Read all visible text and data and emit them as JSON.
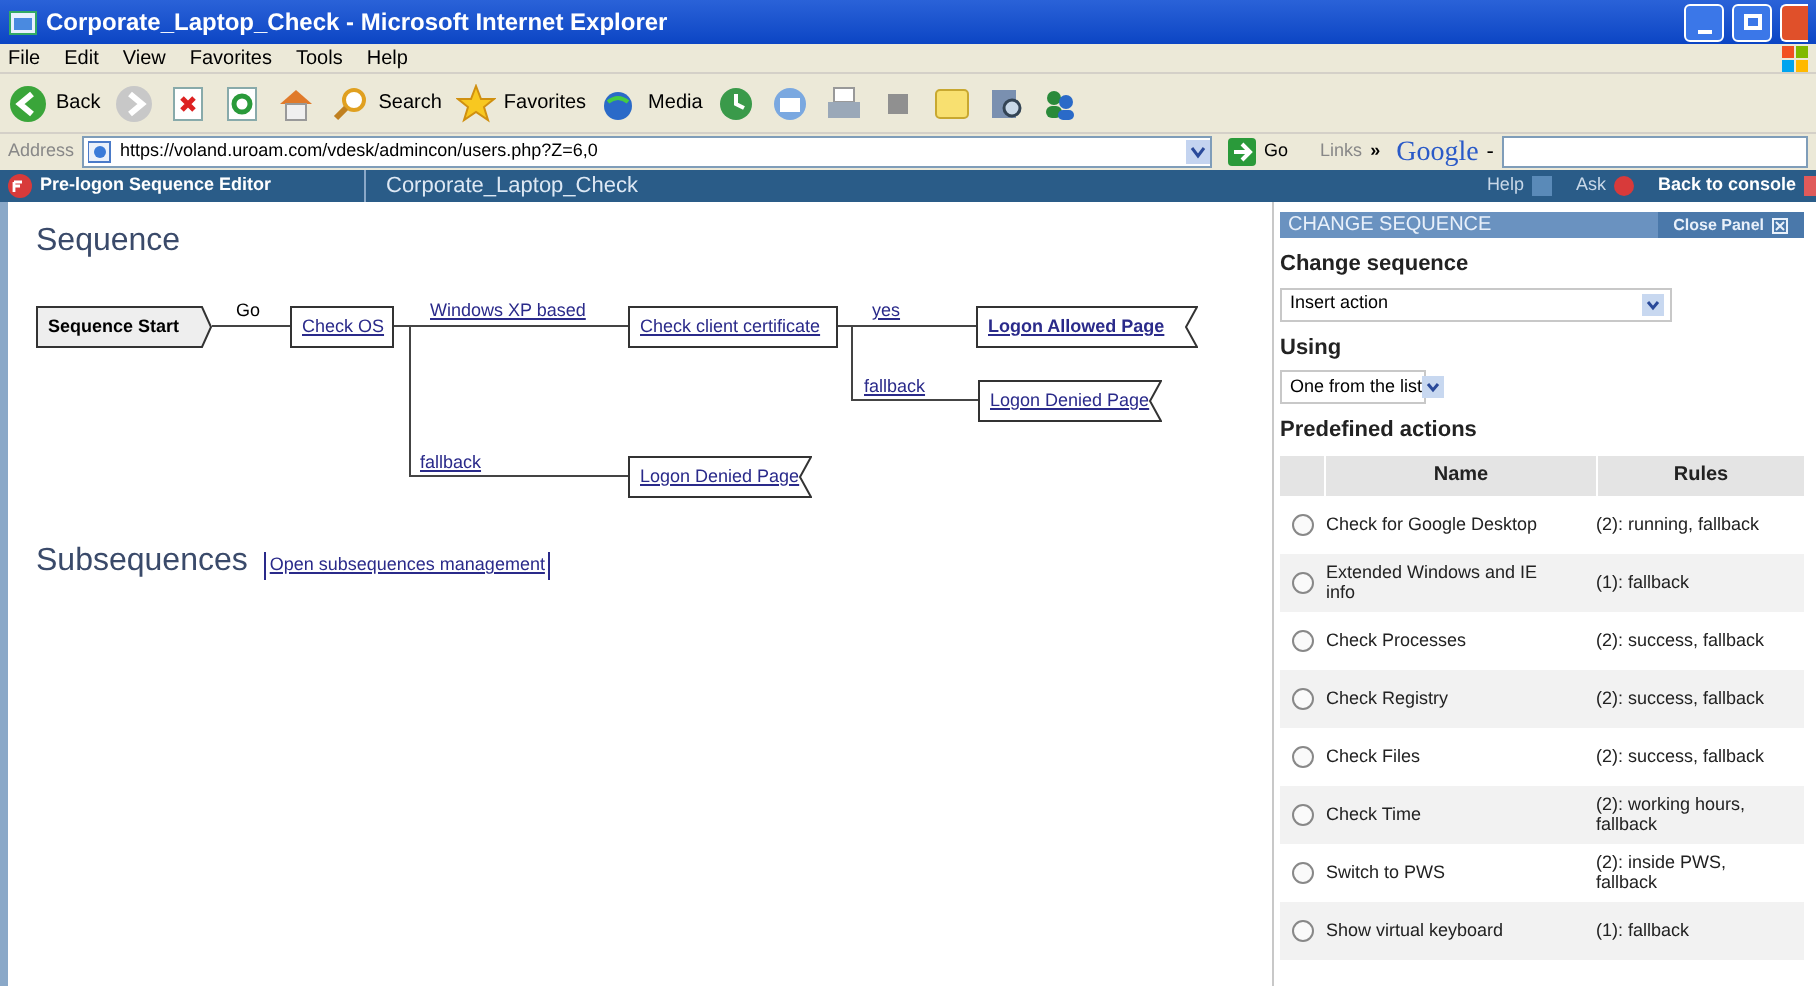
{
  "window": {
    "title": "Corporate_Laptop_Check - Microsoft Internet Explorer"
  },
  "menu": [
    "File",
    "Edit",
    "View",
    "Favorites",
    "Tools",
    "Help"
  ],
  "toolbar": [
    {
      "kind": "back",
      "label": "Back"
    },
    {
      "kind": "forward"
    },
    {
      "kind": "stop"
    },
    {
      "kind": "refresh"
    },
    {
      "kind": "home"
    },
    {
      "kind": "search",
      "label": "Search"
    },
    {
      "kind": "favorites",
      "label": "Favorites"
    },
    {
      "kind": "media",
      "label": "Media"
    },
    {
      "kind": "history"
    },
    {
      "kind": "mail"
    },
    {
      "kind": "print"
    },
    {
      "kind": "edit"
    },
    {
      "kind": "note"
    },
    {
      "kind": "research"
    },
    {
      "kind": "messenger"
    }
  ],
  "address": {
    "label": "Address",
    "url": "https://voland.uroam.com/vdesk/admincon/users.php?Z=6,0",
    "go": "Go",
    "links": "Links",
    "more": "»",
    "google": "Google",
    "google_caret": "-"
  },
  "app_header": {
    "title": "Pre-logon Sequence Editor",
    "tab": "Corporate_Laptop_Check",
    "help": "Help",
    "ask": "Ask",
    "back": "Back to console"
  },
  "sequence": {
    "heading": "Sequence",
    "nodes": [
      {
        "kind": "start",
        "label": "Sequence Start"
      },
      {
        "kind": "action",
        "label": "Check OS"
      },
      {
        "kind": "action",
        "label": "Check client certificate"
      },
      {
        "kind": "page",
        "label": "Logon Allowed Page",
        "bold": true
      },
      {
        "kind": "page",
        "label": "Logon Denied Page",
        "bold": false
      },
      {
        "kind": "page",
        "label": "Logon Denied Page",
        "bold": false
      }
    ],
    "edges": [
      {
        "kind": "text",
        "label": "Go"
      },
      {
        "kind": "link",
        "label": "Windows XP based"
      },
      {
        "kind": "link",
        "label": "yes"
      },
      {
        "kind": "link",
        "label": "fallback"
      },
      {
        "kind": "link",
        "label": "fallback"
      }
    ]
  },
  "subsequences": {
    "heading": "Subsequences",
    "link": "Open subsequences management"
  },
  "panel": {
    "title": "CHANGE SEQUENCE",
    "close": "Close Panel",
    "change_label": "Change sequence",
    "change_value": "Insert action",
    "using_label": "Using",
    "using_value": "One from the list",
    "predefined_label": "Predefined actions",
    "columns": [
      "Name",
      "Rules"
    ],
    "rows": [
      {
        "name": "Check for Google Desktop",
        "rules": "(2): running, fallback",
        "selected": false
      },
      {
        "name": "Extended Windows and IE info",
        "rules": "(1): fallback",
        "selected": false
      },
      {
        "name": "Check Processes",
        "rules": "(2): success, fallback",
        "selected": false
      },
      {
        "name": "Check Registry",
        "rules": "(2): success, fallback",
        "selected": false
      },
      {
        "name": "Check Files",
        "rules": "(2): success, fallback",
        "selected": false
      },
      {
        "name": "Check Time",
        "rules": "(2): working hours, fallback",
        "selected": false
      },
      {
        "name": "Switch to PWS",
        "rules": "(2): inside PWS, fallback",
        "selected": false
      },
      {
        "name": "Show virtual keyboard",
        "rules": "(1): fallback",
        "selected": false
      }
    ]
  }
}
